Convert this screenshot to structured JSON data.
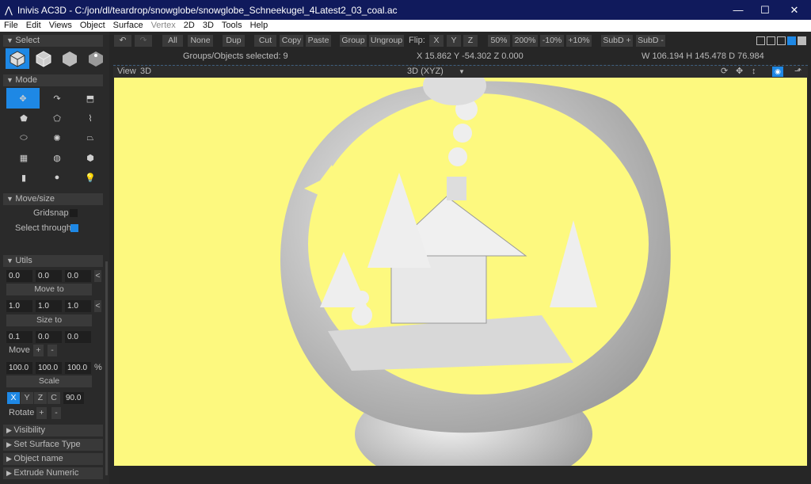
{
  "window": {
    "title": "Inivis AC3D - C:/jon/dl/teardrop/snowglobe/snowglobe_Schneekugel_4Latest2_03_coal.ac",
    "minimize": "—",
    "maximize": "☐",
    "close": "✕"
  },
  "menu": [
    "File",
    "Edit",
    "Views",
    "Object",
    "Surface",
    "Vertex",
    "2D",
    "3D",
    "Tools",
    "Help"
  ],
  "toolbar": {
    "undo": "↶",
    "redo": "↷",
    "all": "All",
    "none": "None",
    "dup": "Dup",
    "cut": "Cut",
    "copy": "Copy",
    "paste": "Paste",
    "group": "Group",
    "ungroup": "Ungroup",
    "flip_label": "Flip:",
    "flip_x": "X",
    "flip_y": "Y",
    "flip_z": "Z",
    "z50": "50%",
    "z200": "200%",
    "m10": "-10%",
    "p10": "+10%",
    "subd_plus": "SubD +",
    "subd_minus": "SubD -"
  },
  "status": {
    "selected": "Groups/Objects selected: 9",
    "cursor": "X 15.862 Y -54.302 Z 0.000",
    "dims": "W 106.194 H 145.478 D 76.984"
  },
  "viewport": {
    "view_menu": "View",
    "view_mode": "3D",
    "projection": "3D (XYZ)",
    "background": "#fdf97f"
  },
  "panel": {
    "select": "Select",
    "mode": "Mode",
    "movesize": "Move/size",
    "gridsnap": "Gridsnap",
    "select_through": "Select through",
    "select_through_checked": true,
    "gridsnap_checked": false,
    "utils": "Utils",
    "move_vals": [
      "0.0",
      "0.0",
      "0.0"
    ],
    "move_to": "Move to",
    "size_vals": [
      "1.0",
      "1.0",
      "1.0"
    ],
    "size_to": "Size to",
    "step_vals": [
      "0.1",
      "0.0",
      "0.0"
    ],
    "move": "Move",
    "scale_vals": [
      "100.0",
      "100.0",
      "100.0"
    ],
    "percent": "%",
    "scale": "Scale",
    "axes": [
      "X",
      "Y",
      "Z",
      "C"
    ],
    "angle": "90.0",
    "rotate": "Rotate",
    "plus": "+",
    "minus": "-",
    "lt": "<",
    "collapsed": [
      "Visibility",
      "Set Surface Type",
      "Object name",
      "Extrude Numeric"
    ]
  }
}
